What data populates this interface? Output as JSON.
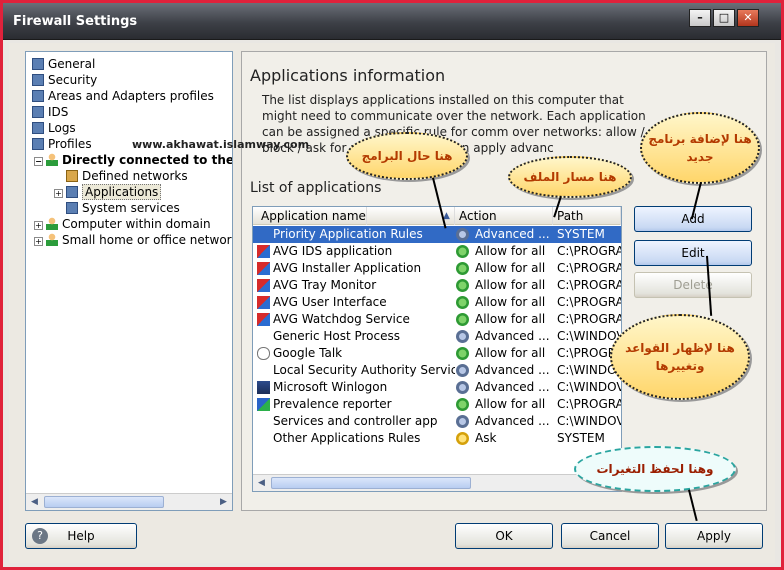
{
  "window": {
    "title": "Firewall Settings"
  },
  "tree": {
    "items": [
      "General",
      "Security",
      "Areas and Adapters profiles",
      "IDS",
      "Logs",
      "Profiles",
      "Directly connected to the",
      "Defined networks",
      "Applications",
      "System services",
      "Computer within domain",
      "Small home or office networ"
    ]
  },
  "watermark": "www.akhawat.islamway.com",
  "panel": {
    "heading": "Applications information",
    "description": "The list displays applications installed on this computer that might need to communicate over the network. Each application can be assigned a specific rule for comm over networks: allow / block / ask for permission. You can apply advanc",
    "list_label": "List of applications"
  },
  "grid": {
    "columns": [
      "Application name",
      "Action",
      "Path"
    ],
    "rows": [
      {
        "name": "Priority Application Rules",
        "action": "Advanced ...",
        "path": "SYSTEM",
        "icon": "none",
        "act": "adv"
      },
      {
        "name": "AVG IDS application",
        "action": "Allow for all",
        "path": "C:\\PROGRA",
        "icon": "avg",
        "act": "allow"
      },
      {
        "name": "AVG Installer Application",
        "action": "Allow for all",
        "path": "C:\\PROGRA",
        "icon": "avg",
        "act": "allow"
      },
      {
        "name": "AVG Tray Monitor",
        "action": "Allow for all",
        "path": "C:\\PROGRA",
        "icon": "avg",
        "act": "allow"
      },
      {
        "name": "AVG User Interface",
        "action": "Allow for all",
        "path": "C:\\PROGRA",
        "icon": "avg",
        "act": "allow"
      },
      {
        "name": "AVG Watchdog Service",
        "action": "Allow for all",
        "path": "C:\\PROGRA",
        "icon": "avg",
        "act": "allow"
      },
      {
        "name": "Generic Host Process",
        "action": "Advanced ...",
        "path": "C:\\WINDOV",
        "icon": "none",
        "act": "adv"
      },
      {
        "name": "Google Talk",
        "action": "Allow for all",
        "path": "C:\\PROGRA",
        "icon": "talk",
        "act": "allow"
      },
      {
        "name": "Local Security Authority Service",
        "action": "Advanced ...",
        "path": "C:\\WINDOV",
        "icon": "none",
        "act": "adv"
      },
      {
        "name": "Microsoft Winlogon",
        "action": "Advanced ...",
        "path": "C:\\WINDOV",
        "icon": "win",
        "act": "adv"
      },
      {
        "name": "Prevalence reporter",
        "action": "Allow for all",
        "path": "C:\\PROGRA",
        "icon": "prev",
        "act": "allow"
      },
      {
        "name": "Services and controller app",
        "action": "Advanced ...",
        "path": "C:\\WINDOV",
        "icon": "none",
        "act": "adv"
      },
      {
        "name": "Other Applications Rules",
        "action": "Ask",
        "path": "SYSTEM",
        "icon": "none",
        "act": "ask"
      }
    ]
  },
  "side_buttons": {
    "add": "Add",
    "edit": "Edit",
    "delete": "Delete"
  },
  "footer": {
    "help": "Help",
    "ok": "OK",
    "cancel": "Cancel",
    "apply": "Apply"
  },
  "callouts": {
    "status": "هنا حال البرامج",
    "path": "هنا مسار الملف",
    "add": "هنا لإضافة برنامج جديد",
    "edit": "هنا لإظهار القواعد وتغييرها",
    "apply": "وهنا لحفظ التغيرات"
  }
}
